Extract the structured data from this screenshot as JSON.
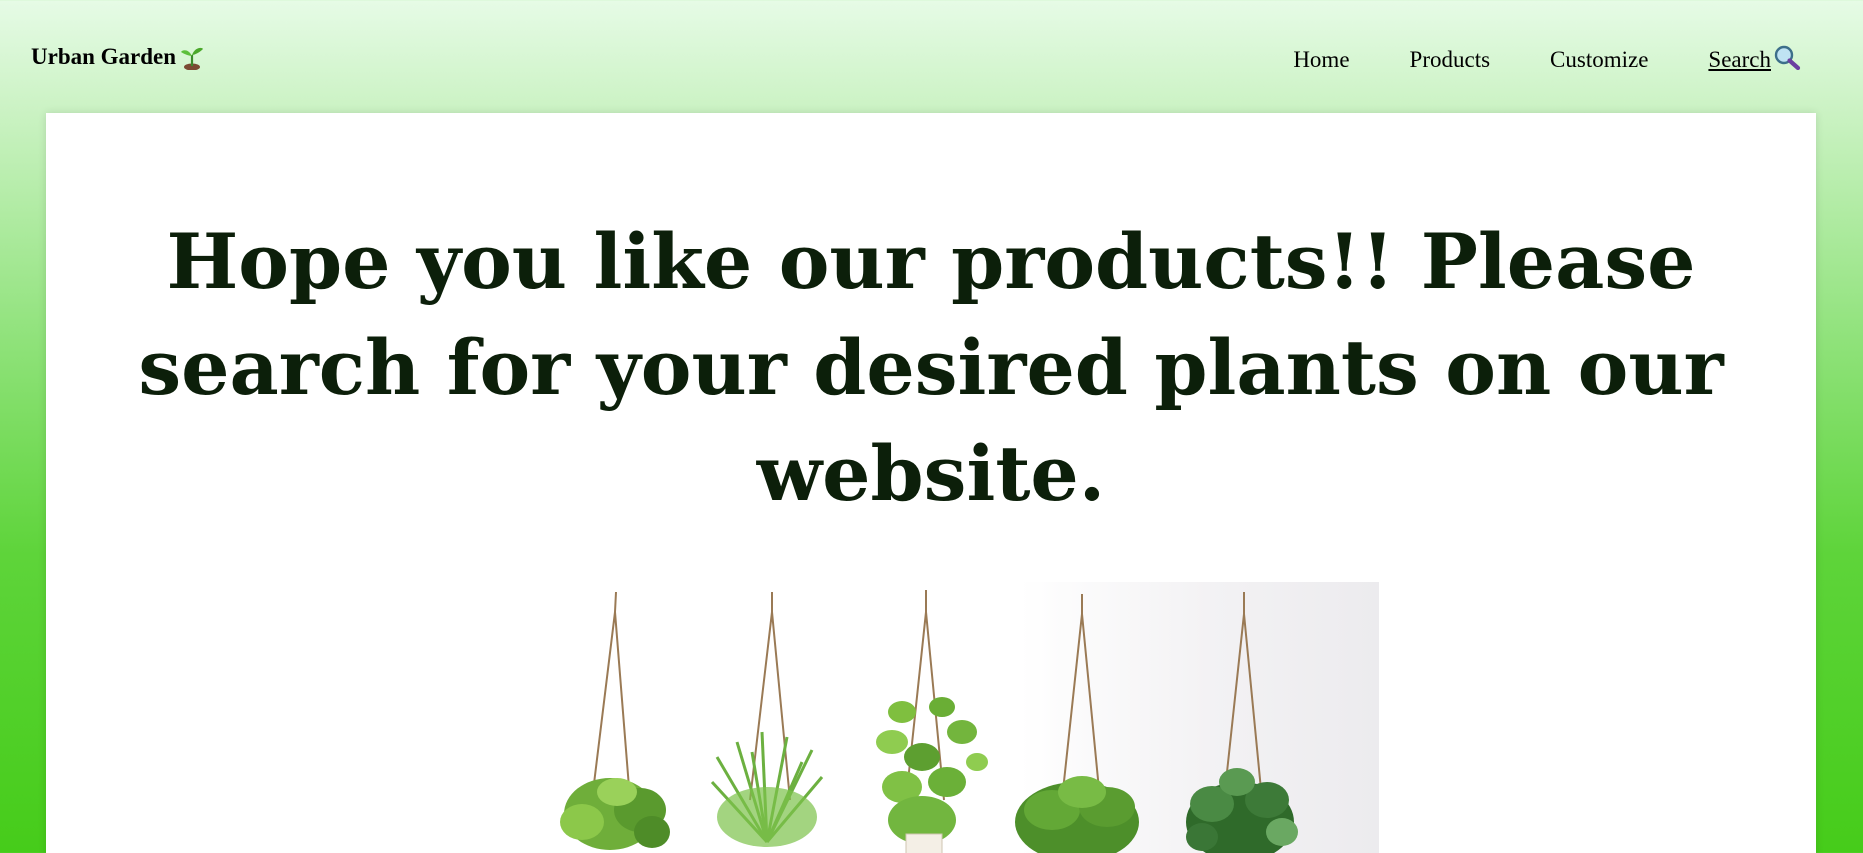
{
  "header": {
    "brand": "Urban Garden",
    "brand_icon": "seedling-icon",
    "nav": [
      {
        "label": "Home"
      },
      {
        "label": "Products"
      },
      {
        "label": "Customize"
      },
      {
        "label": "Search",
        "icon": "magnifier-icon"
      }
    ]
  },
  "main": {
    "headline": "Hope you like our products!! Please search for your desired plants on our website.",
    "image_alt": "Five hanging potted plants"
  },
  "colors": {
    "headline": "#0c1f0a",
    "background_top": "#e6fbe6",
    "background_bottom": "#46cc1a",
    "panel": "#ffffff"
  }
}
